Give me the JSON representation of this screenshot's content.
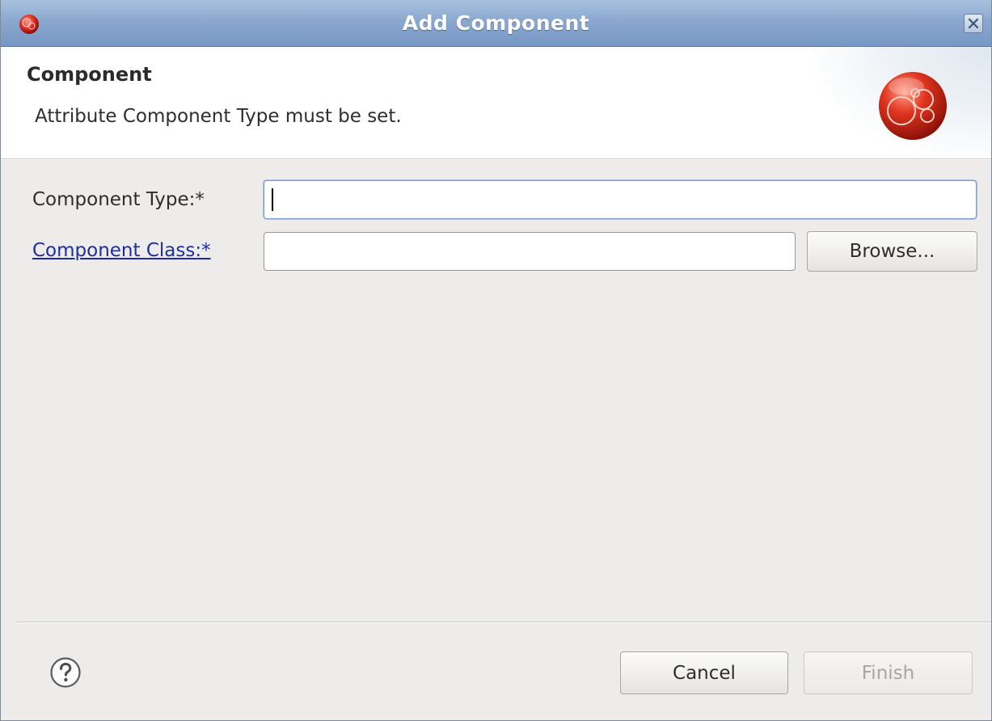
{
  "window": {
    "title": "Add Component",
    "app_icon": "eclipse-icon",
    "close_icon": "close-icon"
  },
  "header": {
    "title": "Component",
    "message": "Attribute Component Type must be set.",
    "image_icon": "wizard-banner-icon"
  },
  "form": {
    "component_type": {
      "label": "Component Type:*",
      "value": "",
      "placeholder": ""
    },
    "component_class": {
      "label": "Component Class:*",
      "value": "",
      "placeholder": ""
    },
    "browse_label": "Browse..."
  },
  "footer": {
    "help_icon": "help-icon",
    "cancel_label": "Cancel",
    "finish_label": "Finish"
  },
  "colors": {
    "titlebar": "#8aa8cf",
    "dialog_background": "#edeceb",
    "link": "#1e2ea0",
    "disabled_text": "#a6a6a6"
  }
}
